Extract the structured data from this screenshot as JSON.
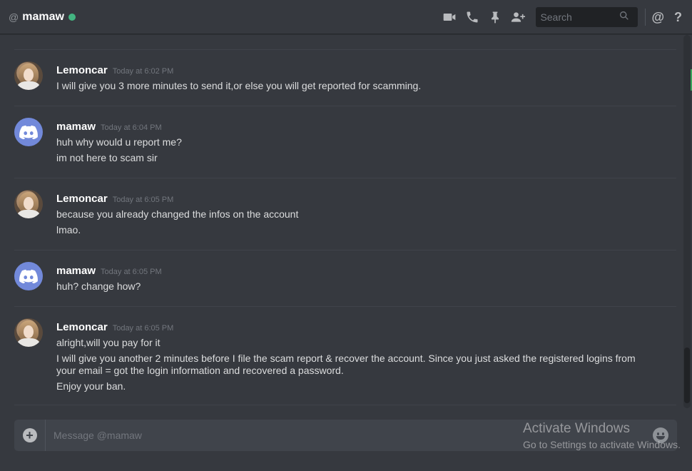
{
  "header": {
    "at_symbol": "@",
    "channel_name": "mamaw",
    "status": "online",
    "status_color": "#43b581",
    "search_placeholder": "Search",
    "icons": [
      "video-call-icon",
      "voice-call-icon",
      "pin-icon",
      "add-friend-icon",
      "search-icon",
      "mention-icon",
      "help-icon"
    ],
    "mention_label": "@",
    "help_label": "?"
  },
  "messages": [
    {
      "author": "Lemoncar",
      "avatar": "photo",
      "timestamp": "Today at 6:02 PM",
      "lines": [
        "I will give you 3 more minutes to send it,or else you will get reported for scamming."
      ]
    },
    {
      "author": "mamaw",
      "avatar": "discord-default",
      "timestamp": "Today at 6:04 PM",
      "lines": [
        "huh why would u report me?",
        "im not here to scam sir"
      ]
    },
    {
      "author": "Lemoncar",
      "avatar": "photo",
      "timestamp": "Today at 6:05 PM",
      "lines": [
        "because you already changed the infos on the account",
        "lmao."
      ]
    },
    {
      "author": "mamaw",
      "avatar": "discord-default",
      "timestamp": "Today at 6:05 PM",
      "lines": [
        "huh? change how?"
      ]
    },
    {
      "author": "Lemoncar",
      "avatar": "photo",
      "timestamp": "Today at 6:05 PM",
      "lines": [
        "alright,will you pay for it",
        "I will give you another 2 minutes before I file the scam report & recover the account. Since you just asked the registered logins from your email = got the login information and recovered a password.",
        "Enjoy your ban."
      ]
    }
  ],
  "composer": {
    "placeholder": "Message @mamaw",
    "value": ""
  },
  "watermark": {
    "title": "Activate Windows",
    "subtitle": "Go to Settings to activate Windows."
  },
  "colors": {
    "background": "#36393f",
    "blurple": "#7289da",
    "username": "#ffffff",
    "timestamp": "#72767d"
  }
}
